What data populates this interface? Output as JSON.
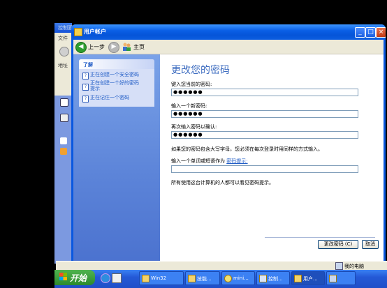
{
  "background_window": {
    "title": "控制面板",
    "menu_first": "文件",
    "address_label": "地址"
  },
  "window": {
    "title": "用户帐户",
    "controls": {
      "minimize": "_",
      "maximize": "□",
      "close": "×"
    }
  },
  "toolbar": {
    "back_label": "上一步",
    "home_label": "主页"
  },
  "left_pane": {
    "learn_title": "了解",
    "items": [
      {
        "label": "正在创建一个安全密码"
      },
      {
        "label": "正在创建一个好的密码提示"
      },
      {
        "label": "正在记住一个密码"
      }
    ]
  },
  "content": {
    "heading": "更改您的密码",
    "current_label": "键入您当前的密码:",
    "current_value": "●●●●●●",
    "new_label": "输入一个新密码:",
    "new_value": "●●●●●●",
    "confirm_label": "再次输入密码以确认:",
    "confirm_value": "●●●●●●",
    "case_note": "如果您的密码包含大写字母，您必须在每次登录时用同样的方式输入。",
    "hint_prefix": "输入一个单词或短语作为",
    "hint_link": "密码提示:",
    "hint_value": "",
    "visible_note": "所有使用这台计算机的人都可以看见密码提示。",
    "change_button": "更改密码 (C)",
    "cancel_button": "取消"
  },
  "statusbar": {
    "location": "我的电脑"
  },
  "taskbar": {
    "start_label": "开始",
    "tasks": [
      {
        "label": "Win32"
      },
      {
        "label": "技能..."
      },
      {
        "label": "mini..."
      },
      {
        "label": "控制..."
      },
      {
        "label": "用户..."
      },
      {
        "label": ""
      }
    ]
  },
  "colors": {
    "title_bar": "#0a5fe6",
    "left_pane": "#6a92df",
    "heading": "#3d6cc0",
    "link": "#215dc6",
    "taskbar": "#2459d6",
    "start": "#2c8a2c"
  }
}
